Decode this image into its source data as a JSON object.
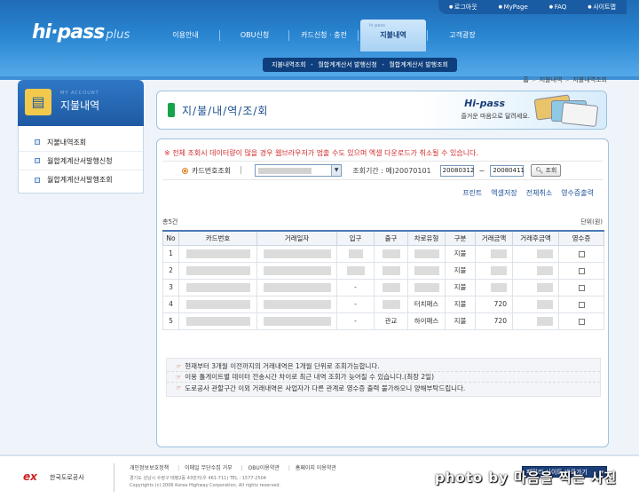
{
  "util_links": [
    "로그아웃",
    "MyPage",
    "FAQ",
    "사이트맵"
  ],
  "logo": {
    "main": "hi·pass",
    "sub": "plus"
  },
  "gnb": [
    {
      "label": "이용안내",
      "active": false
    },
    {
      "label": "OBU신청",
      "active": false
    },
    {
      "label": "카드신청 · 충전",
      "active": false
    },
    {
      "label": "지불내역",
      "active": true,
      "mini": "hi-pass"
    },
    {
      "label": "고객광장",
      "active": false
    }
  ],
  "subnav": [
    "지불내역조회",
    "월합계계산서 발행신청",
    "월합계계산서 발행조회"
  ],
  "breadcrumb": [
    "홈",
    "지불내역",
    "지불내역조회"
  ],
  "sidebar": {
    "eng": "MY ACCOUNT",
    "title": "지불내역",
    "items": [
      "지불내역조회",
      "월합계계산서발행신청",
      "월합계계산서발행조회"
    ]
  },
  "content": {
    "title": "지/불/내/역/조/회",
    "banner_brand": "Hi-pass",
    "banner_slogan": "즐거운 마음으로 달려세요."
  },
  "notice": "※ 전체 조회시 데이터량이 많을 경우 웹브라우저가 멈출 수도 있으며 엑셀 다운로드가 취소될 수 있습니다.",
  "search": {
    "option_label": "카드번호조회",
    "period_label": "조회기간 : 예)20070101",
    "from": "20080312",
    "to": "20080411",
    "button": "조회"
  },
  "actions": [
    "프린트",
    "엑셀저장",
    "전체취소",
    "영수증출력"
  ],
  "summary": "총5건",
  "unit": "단위(원)",
  "table": {
    "headers": [
      "No",
      "카드번호",
      "거래일자",
      "입구",
      "출구",
      "차로유형",
      "구분",
      "거래금액",
      "거래후금액",
      "영수증"
    ],
    "rows": [
      {
        "no": "1",
        "entry": "",
        "exit": "",
        "lane": "",
        "type": "지불",
        "amount": "",
        "after": ""
      },
      {
        "no": "2",
        "entry": "",
        "exit": "",
        "lane": "",
        "type": "지불",
        "amount": "",
        "after": ""
      },
      {
        "no": "3",
        "entry": "-",
        "exit": "",
        "lane": "",
        "type": "지불",
        "amount": "",
        "after": ""
      },
      {
        "no": "4",
        "entry": "-",
        "exit": "",
        "lane": "터치패스",
        "type": "지불",
        "amount": "720",
        "after": ""
      },
      {
        "no": "5",
        "entry": "-",
        "exit": "관교",
        "lane": "하이패스",
        "type": "지불",
        "amount": "720",
        "after": ""
      }
    ]
  },
  "info": [
    "현재부터 3개월 이전까지의 거래내역은 1개월 단위로 조회가능합니다.",
    "이용 톨게이트별 데이터 전송시간 차이로 최근 내역 조회가 늦어질 수 있습니다.(최장 2일)",
    "도로공사 관할구간 이외 거래내역은 사업자가 다른 관계로 영수증 출력 불가하오니 양해부탁드립니다."
  ],
  "footer": {
    "logo": "ex",
    "org": "한국도로공사",
    "links": [
      "개인정보보호정책",
      "이메일 무단수집 거부",
      "OBU이용약관",
      "홈페이지 이용약관"
    ],
    "address": "경기도 성남시 수정구 태평2동 43번지(우 461-711)  TEL : 1577-2504",
    "copyright": "Copyrights (c) 2006 Korea Highway Corporation, All rights reserved.",
    "family_site": "패밀리 사이트 바로가기",
    "watermark": "photo by 마음을 찍는 사진"
  },
  "colors": {
    "header": "#2a86d2",
    "accent_green": "#17a34a",
    "notice_red": "#d12b2b",
    "link_blue": "#1e4f9a"
  }
}
